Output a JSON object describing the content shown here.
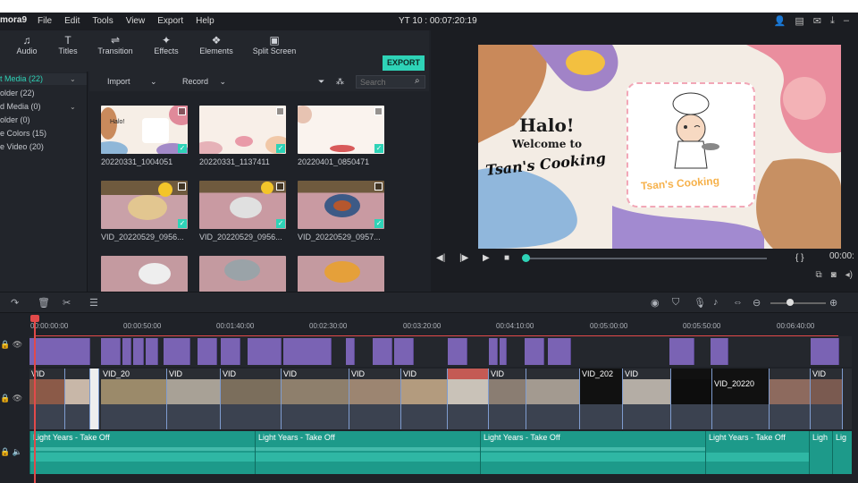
{
  "titlebar": {
    "logo": "mora9",
    "menus": [
      "File",
      "Edit",
      "Tools",
      "View",
      "Export",
      "Help"
    ],
    "window_title": "YT 10 : 00:07:20:19"
  },
  "toolbar": {
    "tools": [
      {
        "label": "Audio",
        "icon": "music-note-icon",
        "glyph": "♫"
      },
      {
        "label": "Titles",
        "icon": "titles-icon",
        "glyph": "T"
      },
      {
        "label": "Transition",
        "icon": "transition-icon",
        "glyph": "⇌"
      },
      {
        "label": "Effects",
        "icon": "effects-icon",
        "glyph": "✦"
      },
      {
        "label": "Elements",
        "icon": "elements-icon",
        "glyph": "❖"
      },
      {
        "label": "Split Screen",
        "icon": "split-screen-icon",
        "glyph": "▣"
      }
    ],
    "export_label": "EXPORT"
  },
  "sidebar": {
    "items": [
      {
        "label": "t Media (22)",
        "selected": true
      },
      {
        "label": "older (22)",
        "selected": false
      },
      {
        "label": "d Media (0)",
        "selected": false
      },
      {
        "label": "older (0)",
        "selected": false
      },
      {
        "label": "e Colors (15)",
        "selected": false
      },
      {
        "label": "e Video (20)",
        "selected": false
      }
    ]
  },
  "mediabar": {
    "import_label": "Import",
    "record_label": "Record",
    "search_placeholder": "Search"
  },
  "media": {
    "items": [
      {
        "caption": "20220331_1004051",
        "kind": "title"
      },
      {
        "caption": "20220331_1137411",
        "kind": "title2"
      },
      {
        "caption": "20220401_0850471",
        "kind": "title3"
      },
      {
        "caption": "VID_20220529_0956...",
        "kind": "bowl1"
      },
      {
        "caption": "VID_20220529_0956...",
        "kind": "bowl2"
      },
      {
        "caption": "VID_20220529_0957...",
        "kind": "bowl3"
      },
      {
        "caption": "",
        "kind": "bowl4"
      },
      {
        "caption": "",
        "kind": "bowl5"
      },
      {
        "caption": "",
        "kind": "bowl6"
      }
    ]
  },
  "preview": {
    "halo": "Halo!",
    "welcome": "Welcome to",
    "tsan": "Tsan's Cooking",
    "badge_text": "Tsan's Cooking",
    "timecode": "00:00:"
  },
  "timeline": {
    "ruler_labels": [
      "00:00:00:00",
      "00:00:50:00",
      "00:01:40:00",
      "00:02:30:00",
      "00:03:20:00",
      "00:04:10:00",
      "00:05:00:00",
      "00:05:50:00",
      "00:06:40:00"
    ],
    "video_clip_labels": [
      "VID",
      "VID_20",
      "VID",
      "VID",
      "VID",
      "VID",
      "VID",
      "VID",
      "VID_202",
      "VID",
      "VID_20220",
      "VID"
    ],
    "audio_clip_label": "Light Years - Take Off",
    "audio_clip_short": "Ligh",
    "audio_clip_short2": "Lig"
  },
  "colors": {
    "accent": "#2ed3b7",
    "playhead": "#e24a4a",
    "purple_clip": "#7a63b4",
    "audio": "#1d9a8a"
  }
}
